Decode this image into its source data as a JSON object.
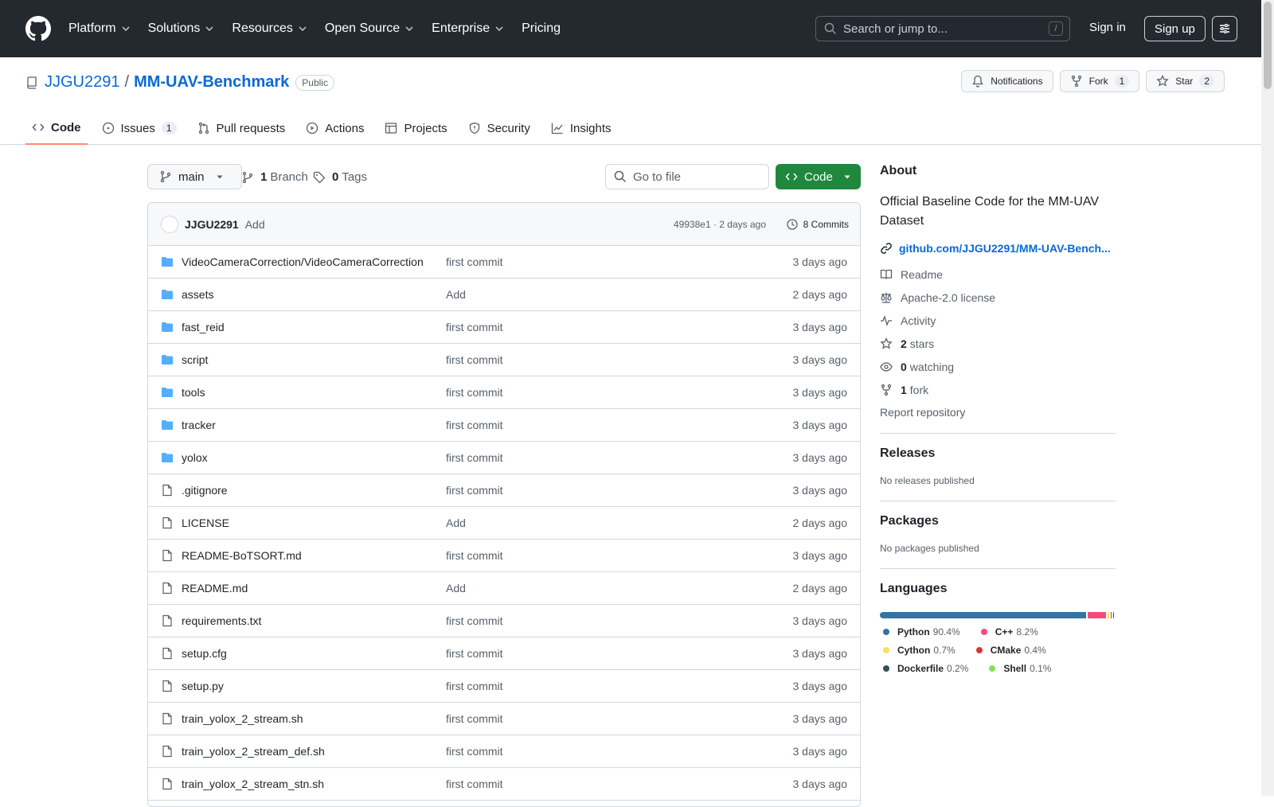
{
  "header": {
    "nav": [
      "Platform",
      "Solutions",
      "Resources",
      "Open Source",
      "Enterprise",
      "Pricing"
    ],
    "nav_has_chevron": [
      true,
      true,
      true,
      true,
      true,
      false
    ],
    "search_placeholder": "Search or jump to...",
    "search_shortcut": "/",
    "signin": "Sign in",
    "signup": "Sign up"
  },
  "repo": {
    "owner": "JJGU2291",
    "separator": "/",
    "name": "MM-UAV-Benchmark",
    "visibility": "Public",
    "notifications_label": "Notifications",
    "fork_label": "Fork",
    "fork_count": "1",
    "star_label": "Star",
    "star_count": "2"
  },
  "tabs": [
    {
      "label": "Code",
      "icon": "code-icon",
      "count": ""
    },
    {
      "label": "Issues",
      "icon": "issue-icon",
      "count": "1"
    },
    {
      "label": "Pull requests",
      "icon": "pull-request-icon",
      "count": ""
    },
    {
      "label": "Actions",
      "icon": "play-icon",
      "count": ""
    },
    {
      "label": "Projects",
      "icon": "table-icon",
      "count": ""
    },
    {
      "label": "Security",
      "icon": "shield-icon",
      "count": ""
    },
    {
      "label": "Insights",
      "icon": "graph-icon",
      "count": ""
    }
  ],
  "toolbar": {
    "branch": "main",
    "branch_count": "1",
    "branch_label": "Branch",
    "tag_count": "0",
    "tag_label": "Tags",
    "goto_placeholder": "Go to file",
    "code_label": "Code"
  },
  "commit": {
    "author": "JJGU2291",
    "message": "Add",
    "sha_time": "49938e1 · 2 days ago",
    "commits_label": "8 Commits"
  },
  "files": [
    {
      "name": "VideoCameraCorrection/VideoCameraCorrection",
      "type": "folder",
      "msg": "first commit",
      "age": "3 days ago"
    },
    {
      "name": "assets",
      "type": "folder",
      "msg": "Add",
      "age": "2 days ago"
    },
    {
      "name": "fast_reid",
      "type": "folder",
      "msg": "first commit",
      "age": "3 days ago"
    },
    {
      "name": "script",
      "type": "folder",
      "msg": "first commit",
      "age": "3 days ago"
    },
    {
      "name": "tools",
      "type": "folder",
      "msg": "first commit",
      "age": "3 days ago"
    },
    {
      "name": "tracker",
      "type": "folder",
      "msg": "first commit",
      "age": "3 days ago"
    },
    {
      "name": "yolox",
      "type": "folder",
      "msg": "first commit",
      "age": "3 days ago"
    },
    {
      "name": ".gitignore",
      "type": "file",
      "msg": "first commit",
      "age": "3 days ago"
    },
    {
      "name": "LICENSE",
      "type": "file",
      "msg": "Add",
      "age": "2 days ago"
    },
    {
      "name": "README-BoTSORT.md",
      "type": "file",
      "msg": "first commit",
      "age": "3 days ago"
    },
    {
      "name": "README.md",
      "type": "file",
      "msg": "Add",
      "age": "2 days ago"
    },
    {
      "name": "requirements.txt",
      "type": "file",
      "msg": "first commit",
      "age": "3 days ago"
    },
    {
      "name": "setup.cfg",
      "type": "file",
      "msg": "first commit",
      "age": "3 days ago"
    },
    {
      "name": "setup.py",
      "type": "file",
      "msg": "first commit",
      "age": "3 days ago"
    },
    {
      "name": "train_yolox_2_stream.sh",
      "type": "file",
      "msg": "first commit",
      "age": "3 days ago"
    },
    {
      "name": "train_yolox_2_stream_def.sh",
      "type": "file",
      "msg": "first commit",
      "age": "3 days ago"
    },
    {
      "name": "train_yolox_2_stream_stn.sh",
      "type": "file",
      "msg": "first commit",
      "age": "3 days ago"
    }
  ],
  "about": {
    "title": "About",
    "description": "Official Baseline Code for the MM-UAV Dataset",
    "link": "github.com/JJGU2291/MM-UAV-Bench...",
    "readme": "Readme",
    "license": "Apache-2.0 license",
    "activity": "Activity",
    "stars_count": "2",
    "stars_label": "stars",
    "watching_count": "0",
    "watching_label": "watching",
    "forks_count": "1",
    "forks_label": "fork",
    "report": "Report repository"
  },
  "releases": {
    "title": "Releases",
    "empty": "No releases published"
  },
  "packages": {
    "title": "Packages",
    "empty": "No packages published"
  },
  "languages": {
    "title": "Languages",
    "items": [
      {
        "name": "Python",
        "pct": "90.4%",
        "value": 90.4,
        "color": "#3572A5"
      },
      {
        "name": "C++",
        "pct": "8.2%",
        "value": 8.2,
        "color": "#f34b7d"
      },
      {
        "name": "Cython",
        "pct": "0.7%",
        "value": 0.7,
        "color": "#fedf5b"
      },
      {
        "name": "CMake",
        "pct": "0.4%",
        "value": 0.4,
        "color": "#DA3434"
      },
      {
        "name": "Dockerfile",
        "pct": "0.2%",
        "value": 0.2,
        "color": "#384d54"
      },
      {
        "name": "Shell",
        "pct": "0.1%",
        "value": 0.1,
        "color": "#89e051"
      }
    ]
  },
  "colors": {
    "accent": "#0969da",
    "header_bg": "#24292f",
    "code_button": "#1f883d",
    "tab_underline": "#fd8c73",
    "folder": "#54aeff"
  }
}
